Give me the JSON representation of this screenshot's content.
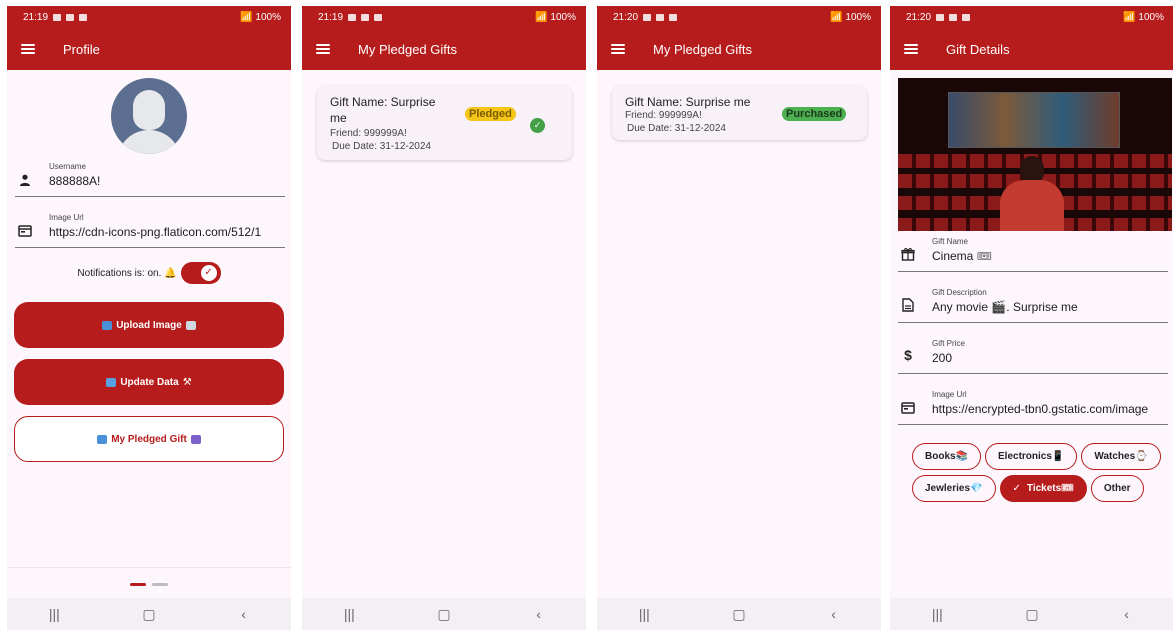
{
  "status": {
    "time1": "21:19",
    "time2": "21:19",
    "time3": "21:20",
    "time4": "21:20",
    "battery": "100%"
  },
  "profile": {
    "title": "Profile",
    "username_label": "Username",
    "username_value": "888888A!",
    "image_url_label": "Image Url",
    "image_url_value": "https://cdn-icons-png.flaticon.com/512/1",
    "notifications_text": "Notifications is: on. 🔔",
    "upload_button": "Upload Image",
    "update_button": "Update Data",
    "pledged_button": "My Pledged Gift"
  },
  "pledged1": {
    "title": "My Pledged Gifts",
    "gift_name": "Gift Name: Surprise me",
    "friend": "Friend: 999999A!",
    "due_date": "Due Date: 31-12-2024",
    "status": "Pledged"
  },
  "pledged2": {
    "title": "My Pledged Gifts",
    "gift_name": "Gift Name: Surprise me",
    "friend": "Friend: 999999A!",
    "due_date": "Due Date: 31-12-2024",
    "status": "Purchased"
  },
  "details": {
    "title": "Gift Details",
    "name_label": "Gift Name",
    "name_value": "Cinema 🎟",
    "desc_label": "Gift Description",
    "desc_value": "Any movie 🎬. Surprise me",
    "price_label": "Gift Price",
    "price_value": "200",
    "url_label": "Image Url",
    "url_value": "https://encrypted-tbn0.gstatic.com/image",
    "categories": [
      "Books📚",
      "Electronics📱",
      "Watches⌚",
      "Jewleries💎",
      "Tickets🎟",
      "Other"
    ],
    "selected_category": "Tickets🎟"
  },
  "colors": {
    "primary": "#b71c1c",
    "pledged": "#f5c518",
    "purchased": "#4caf50"
  }
}
